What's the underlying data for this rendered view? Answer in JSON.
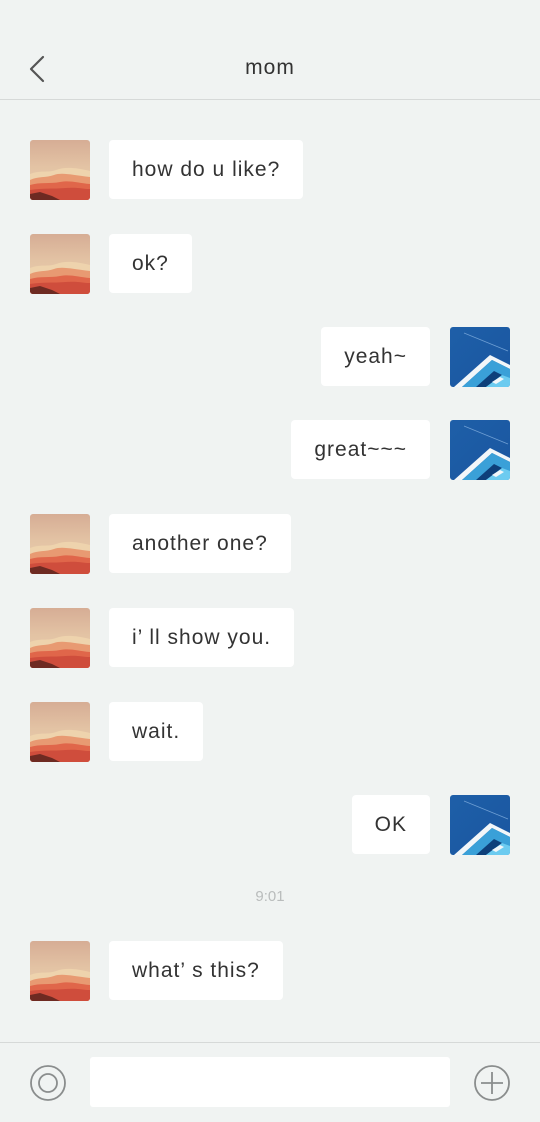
{
  "header": {
    "title": "mom",
    "back_icon": "chevron-left-icon"
  },
  "messages": [
    {
      "side": "left",
      "text": "how do u like?",
      "avatar": "desert-landscape-avatar"
    },
    {
      "side": "left",
      "text": "ok?",
      "avatar": "desert-landscape-avatar"
    },
    {
      "side": "right",
      "text": "yeah~",
      "avatar": "blue-building-avatar"
    },
    {
      "side": "right",
      "text": "great~~~",
      "avatar": "blue-building-avatar"
    },
    {
      "side": "left",
      "text": "another one?",
      "avatar": "desert-landscape-avatar"
    },
    {
      "side": "left",
      "text": "i’ ll show you.",
      "avatar": "desert-landscape-avatar"
    },
    {
      "side": "left",
      "text": "wait.",
      "avatar": "desert-landscape-avatar"
    },
    {
      "side": "right",
      "text": "OK",
      "avatar": "blue-building-avatar"
    },
    {
      "side": "left",
      "text": "what’ s this?",
      "avatar": "desert-landscape-avatar"
    }
  ],
  "timestamp": "9:01",
  "footer": {
    "voice_icon": "voice-circle-icon",
    "input_value": "",
    "plus_icon": "plus-circle-icon"
  },
  "colors": {
    "background": "#f0f3f2",
    "bubble": "#ffffff",
    "text": "#333333",
    "timestamp": "#b9bcbc",
    "divider": "#d6d9d8"
  }
}
